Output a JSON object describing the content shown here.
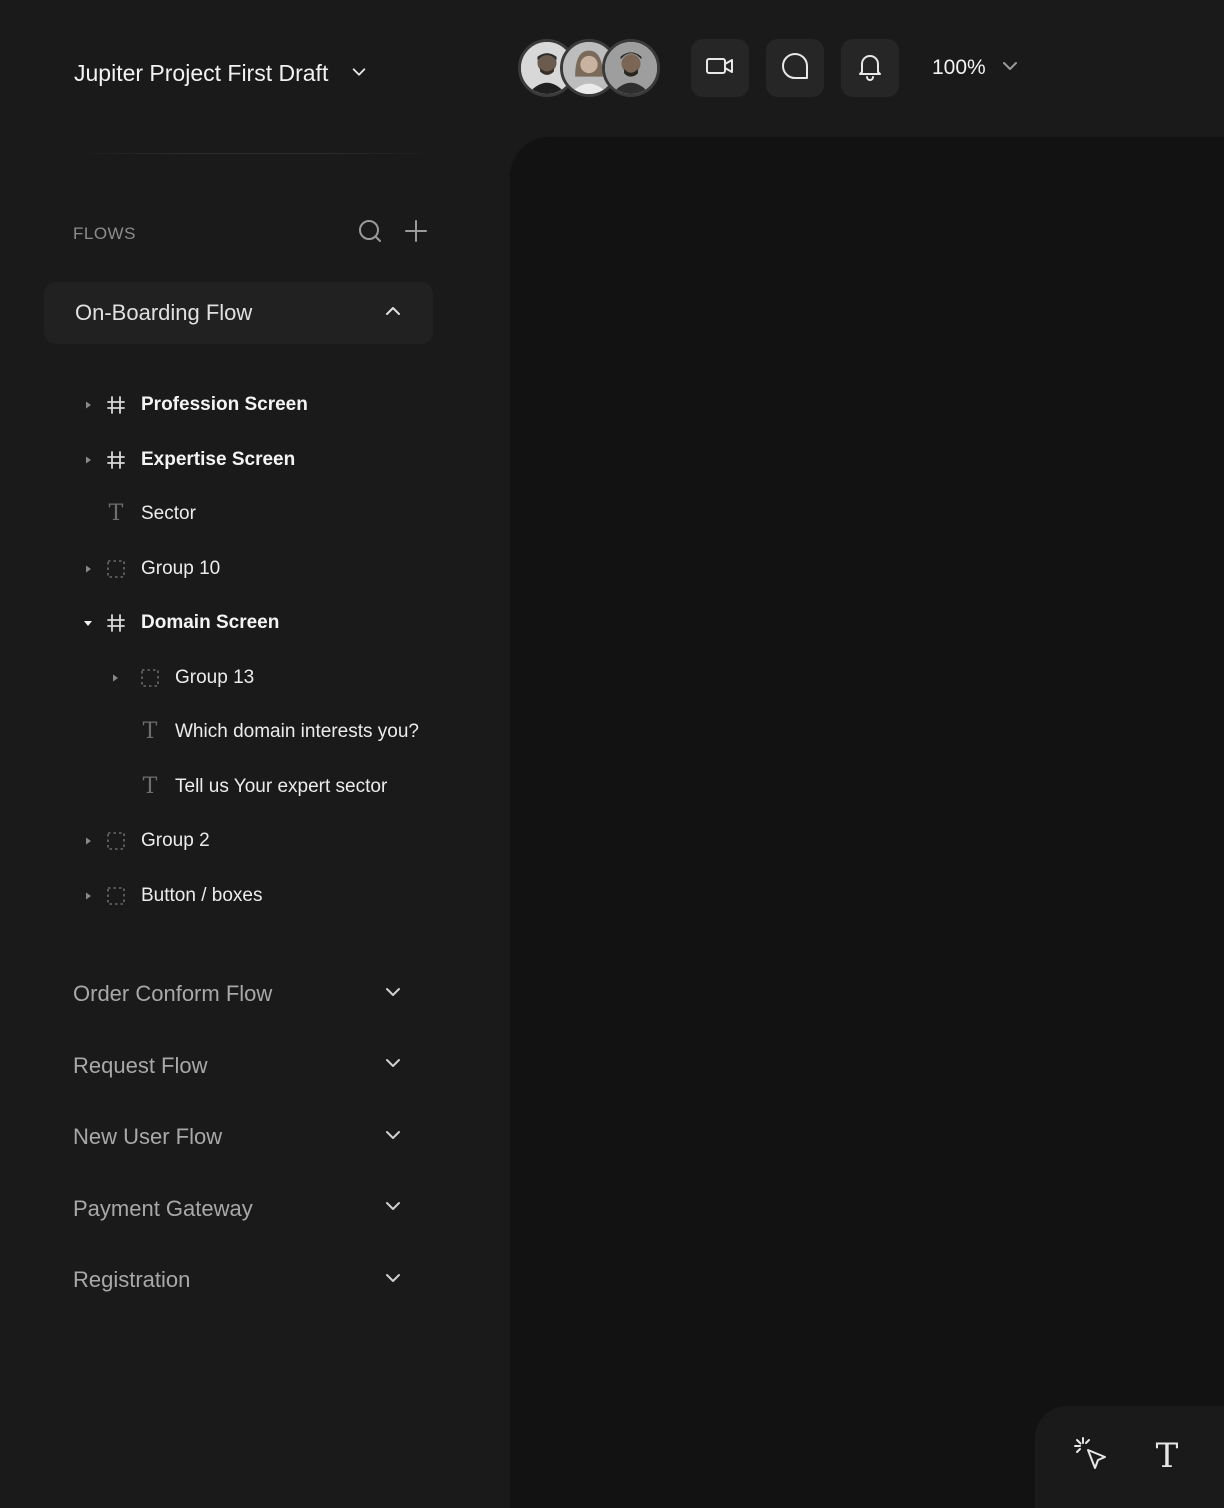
{
  "project": {
    "title": "Jupiter Project First Draft",
    "menu_icon": "chevron-down-icon"
  },
  "flows": {
    "header_label": "FLOWS",
    "search_icon": "search-icon",
    "add_icon": "plus-icon",
    "active_flow": {
      "label": "On-Boarding Flow",
      "expanded": true,
      "layers": [
        {
          "label": "Profession Screen",
          "type": "frame",
          "caret": "collapsed",
          "bold": true,
          "depth": 0
        },
        {
          "label": "Expertise Screen",
          "type": "frame",
          "caret": "collapsed",
          "bold": true,
          "depth": 0
        },
        {
          "label": "Sector",
          "type": "text",
          "caret": "none",
          "bold": false,
          "depth": 0
        },
        {
          "label": "Group 10",
          "type": "group",
          "caret": "collapsed",
          "bold": false,
          "depth": 0
        },
        {
          "label": "Domain Screen",
          "type": "frame",
          "caret": "expanded",
          "bold": true,
          "depth": 0
        },
        {
          "label": "Group 13",
          "type": "group",
          "caret": "collapsed",
          "bold": false,
          "depth": 1
        },
        {
          "label": "Which domain interests you?",
          "type": "text",
          "caret": "none",
          "bold": false,
          "depth": 1
        },
        {
          "label": "Tell us Your expert sector",
          "type": "text",
          "caret": "none",
          "bold": false,
          "depth": 1
        },
        {
          "label": "Group 2",
          "type": "group",
          "caret": "collapsed",
          "bold": false,
          "depth": 0
        },
        {
          "label": "Button / boxes",
          "type": "group",
          "caret": "collapsed",
          "bold": false,
          "depth": 0
        }
      ]
    },
    "items": [
      {
        "label": "Order Conform Flow"
      },
      {
        "label": "Request Flow"
      },
      {
        "label": "New User Flow"
      },
      {
        "label": "Payment Gateway"
      },
      {
        "label": "Registration"
      }
    ]
  },
  "topbar": {
    "collaborators": [
      "collaborator-1",
      "collaborator-2",
      "collaborator-3"
    ],
    "buttons": [
      {
        "name": "video-call-button",
        "icon": "video-camera-icon"
      },
      {
        "name": "comments-button",
        "icon": "chat-bubble-icon"
      },
      {
        "name": "notifications-button",
        "icon": "bell-icon"
      }
    ],
    "zoom": "100%"
  },
  "toolbar": {
    "tools": [
      {
        "name": "select-tool",
        "icon": "cursor-click-icon"
      },
      {
        "name": "text-tool",
        "icon": "text-tool-icon",
        "glyph": "T"
      }
    ]
  },
  "colors": {
    "background": "#1a1a1a",
    "canvas": "#121212",
    "active_flow_bg": "#212121",
    "button_bg": "#262626",
    "muted_text": "#a8a8a8"
  }
}
